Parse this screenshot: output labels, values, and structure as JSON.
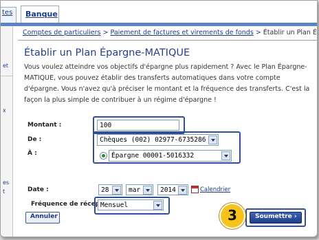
{
  "tabs": {
    "previous_label": "tes",
    "active_label": "Banque"
  },
  "leftnav": {
    "items": [
      "et",
      "x",
      "es",
      "t"
    ]
  },
  "breadcrumb": {
    "link1": "Comptes de particuliers",
    "sep1": " > ",
    "link2": "Paiement de factures et virements de fonds",
    "sep2": " > ",
    "current": "Établir un Plan Épargne-MATIQUE"
  },
  "page": {
    "title": "Établir un Plan Épargne-MATIQUE",
    "intro": "Vous voulez atteindre vos objectifs d'épargne plus rapidement ? Avec le Plan Épargne-MATIQUE, vous pouvez établir des transferts automatiques dans votre compte d'épargne. Vous n'avez qu'à préciser le montant et la fréquence des transferts. C'est la façon la plus simple de contribuer à un régime d'épargne !"
  },
  "form": {
    "montant_label": "Montant :",
    "montant_value": "100",
    "de_label": "De :",
    "de_value": "Chèques (002) 02977-6735286",
    "a_label": "À :",
    "a_value": "Épargne 00001-5016332",
    "date_label": "Date :",
    "date_day": "28",
    "date_month": "mar",
    "date_year": "2014",
    "calendar_label": "Calendrier",
    "frequence_label": "Fréquence de réception:",
    "frequence_value": "Mensuel"
  },
  "buttons": {
    "annuler": "Annuler",
    "soumettre": "Soumettre ›"
  },
  "step_badge": "3",
  "colors": {
    "accent_blue": "#24408e",
    "highlight_border": "#2d4f9e",
    "badge_yellow": "#f7c21a",
    "submit_blue": "#1f3f8a"
  }
}
